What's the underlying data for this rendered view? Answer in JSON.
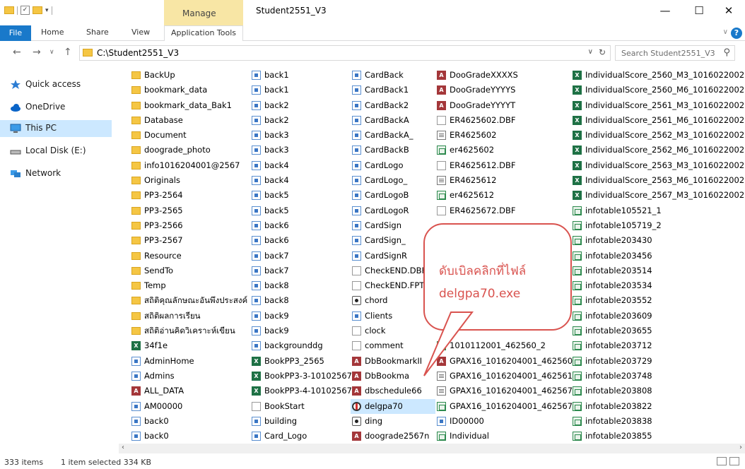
{
  "window": {
    "title": "Student2551_V3",
    "manage_label": "Manage",
    "minimize": "—",
    "maximize": "☐",
    "close": "✕"
  },
  "ribbon": {
    "tabs": [
      "File",
      "Home",
      "Share",
      "View",
      "Application Tools"
    ],
    "help": "?"
  },
  "address": {
    "path": "C:\\Student2551_V3",
    "search_placeholder": "Search Student2551_V3"
  },
  "nav": [
    {
      "label": "Quick access",
      "icon": "star-icon"
    },
    {
      "label": "OneDrive",
      "icon": "cloud-icon"
    },
    {
      "label": "This PC",
      "icon": "computer-icon",
      "selected": true
    },
    {
      "label": "Local Disk (E:)",
      "icon": "drive-icon"
    },
    {
      "label": "Network",
      "icon": "network-icon"
    }
  ],
  "columns": [
    {
      "items": [
        {
          "name": "BackUp",
          "type": "folder"
        },
        {
          "name": "bookmark_data",
          "type": "folder"
        },
        {
          "name": "bookmark_data_Bak1",
          "type": "folder"
        },
        {
          "name": "Database",
          "type": "folder"
        },
        {
          "name": "Document",
          "type": "folder"
        },
        {
          "name": "doograde_photo",
          "type": "folder"
        },
        {
          "name": "info1016204001@2567",
          "type": "folder"
        },
        {
          "name": "Originals",
          "type": "folder"
        },
        {
          "name": "PP3-2564",
          "type": "folder"
        },
        {
          "name": "PP3-2565",
          "type": "folder"
        },
        {
          "name": "PP3-2566",
          "type": "folder"
        },
        {
          "name": "PP3-2567",
          "type": "folder"
        },
        {
          "name": "Resource",
          "type": "folder"
        },
        {
          "name": "SendTo",
          "type": "folder"
        },
        {
          "name": "Temp",
          "type": "folder"
        },
        {
          "name": "สถิติคุณลักษณะอันพึงประสงค์",
          "type": "folder"
        },
        {
          "name": "สถิติผลการเรียน",
          "type": "folder"
        },
        {
          "name": "สถิติอ่านคิดวิเคราะห์เขียน",
          "type": "folder"
        },
        {
          "name": "34f1e",
          "type": "excel"
        },
        {
          "name": "AdminHome",
          "type": "form"
        },
        {
          "name": "Admins",
          "type": "form"
        },
        {
          "name": "ALL_DATA",
          "type": "access"
        },
        {
          "name": "AM00000",
          "type": "form"
        },
        {
          "name": "back0",
          "type": "form"
        },
        {
          "name": "back0",
          "type": "form"
        }
      ]
    },
    {
      "items": [
        {
          "name": "back1",
          "type": "form"
        },
        {
          "name": "back1",
          "type": "form"
        },
        {
          "name": "back2",
          "type": "form"
        },
        {
          "name": "back2",
          "type": "form"
        },
        {
          "name": "back3",
          "type": "form"
        },
        {
          "name": "back3",
          "type": "form"
        },
        {
          "name": "back4",
          "type": "form"
        },
        {
          "name": "back4",
          "type": "form"
        },
        {
          "name": "back5",
          "type": "form"
        },
        {
          "name": "back5",
          "type": "form"
        },
        {
          "name": "back6",
          "type": "form"
        },
        {
          "name": "back6",
          "type": "form"
        },
        {
          "name": "back7",
          "type": "form"
        },
        {
          "name": "back7",
          "type": "form"
        },
        {
          "name": "back8",
          "type": "form"
        },
        {
          "name": "back8",
          "type": "form"
        },
        {
          "name": "back9",
          "type": "form"
        },
        {
          "name": "back9",
          "type": "form"
        },
        {
          "name": "backgrounddg",
          "type": "form"
        },
        {
          "name": "BookPP3_2565",
          "type": "excel"
        },
        {
          "name": "BookPP3-3-10102567",
          "type": "excel"
        },
        {
          "name": "BookPP3-4-10102567",
          "type": "excel"
        },
        {
          "name": "BookStart",
          "type": "doc"
        },
        {
          "name": "building",
          "type": "form"
        },
        {
          "name": "Card_Logo",
          "type": "form"
        }
      ]
    },
    {
      "items": [
        {
          "name": "CardBack",
          "type": "form"
        },
        {
          "name": "CardBack1",
          "type": "form"
        },
        {
          "name": "CardBack2",
          "type": "form"
        },
        {
          "name": "CardBackA",
          "type": "form"
        },
        {
          "name": "CardBackA_",
          "type": "form"
        },
        {
          "name": "CardBackB",
          "type": "form"
        },
        {
          "name": "CardLogo",
          "type": "form"
        },
        {
          "name": "CardLogo_",
          "type": "form"
        },
        {
          "name": "CardLogoB",
          "type": "form"
        },
        {
          "name": "CardLogoR",
          "type": "form"
        },
        {
          "name": "CardSign",
          "type": "form"
        },
        {
          "name": "CardSign_",
          "type": "form"
        },
        {
          "name": "CardSignR",
          "type": "form"
        },
        {
          "name": "CheckEND.DBF",
          "type": "doc"
        },
        {
          "name": "CheckEND.FPT",
          "type": "doc"
        },
        {
          "name": "chord",
          "type": "chord"
        },
        {
          "name": "Clients",
          "type": "form"
        },
        {
          "name": "clock",
          "type": "doc"
        },
        {
          "name": "comment",
          "type": "doc"
        },
        {
          "name": "DbBookmarkII",
          "type": "access"
        },
        {
          "name": "DbBookma",
          "type": "access"
        },
        {
          "name": "dbschedule66",
          "type": "access"
        },
        {
          "name": "delgpa70",
          "type": "exe",
          "selected": true
        },
        {
          "name": "ding",
          "type": "chord"
        },
        {
          "name": "doograde2567n",
          "type": "access"
        }
      ]
    },
    {
      "items": [
        {
          "name": "DooGradeXXXXS",
          "type": "access"
        },
        {
          "name": "DooGradeYYYYS",
          "type": "access"
        },
        {
          "name": "DooGradeYYYYT",
          "type": "access"
        },
        {
          "name": "ER4625602.DBF",
          "type": "doc"
        },
        {
          "name": "ER4625602",
          "type": "dbf"
        },
        {
          "name": "er4625602",
          "type": "table"
        },
        {
          "name": "ER4625612.DBF",
          "type": "doc"
        },
        {
          "name": "ER4625612",
          "type": "dbf"
        },
        {
          "name": "er4625612",
          "type": "table"
        },
        {
          "name": "ER4625672.DBF",
          "type": "doc"
        },
        {
          "name": "",
          "type": "none"
        },
        {
          "name": "",
          "type": "none"
        },
        {
          "name": "",
          "type": "none"
        },
        {
          "name": "",
          "type": "none"
        },
        {
          "name": "",
          "type": "none"
        },
        {
          "name": "",
          "type": "none"
        },
        {
          "name": "",
          "type": "none"
        },
        {
          "name": "",
          "type": "none"
        },
        {
          "name": "1010112001_462560_2",
          "type": "table"
        },
        {
          "name": "GPAX16_1016204001_462560_2",
          "type": "access"
        },
        {
          "name": "GPAX16_1016204001_462561_2",
          "type": "dbf"
        },
        {
          "name": "GPAX16_1016204001_462567_2",
          "type": "dbf"
        },
        {
          "name": "GPAX16_1016204001_462567_2",
          "type": "table"
        },
        {
          "name": "ID00000",
          "type": "form"
        },
        {
          "name": "Individual",
          "type": "table"
        }
      ]
    },
    {
      "items": [
        {
          "name": "IndividualScore_2560_M3_1016022002",
          "type": "excel"
        },
        {
          "name": "IndividualScore_2560_M6_1016022002",
          "type": "excel"
        },
        {
          "name": "IndividualScore_2561_M3_1016022002",
          "type": "excel"
        },
        {
          "name": "IndividualScore_2561_M6_1016022002",
          "type": "excel"
        },
        {
          "name": "IndividualScore_2562_M3_1016022002",
          "type": "excel"
        },
        {
          "name": "IndividualScore_2562_M6_1016022002",
          "type": "excel"
        },
        {
          "name": "IndividualScore_2563_M3_1016022002",
          "type": "excel"
        },
        {
          "name": "IndividualScore_2563_M6_1016022002",
          "type": "excel"
        },
        {
          "name": "IndividualScore_2567_M3_1016022002",
          "type": "excel"
        },
        {
          "name": "infotable105521_1",
          "type": "table"
        },
        {
          "name": "infotable105719_2",
          "type": "table"
        },
        {
          "name": "infotable203430",
          "type": "table"
        },
        {
          "name": "infotable203456",
          "type": "table"
        },
        {
          "name": "infotable203514",
          "type": "table"
        },
        {
          "name": "infotable203534",
          "type": "table"
        },
        {
          "name": "infotable203552",
          "type": "table"
        },
        {
          "name": "infotable203609",
          "type": "table"
        },
        {
          "name": "infotable203655",
          "type": "table"
        },
        {
          "name": "infotable203712",
          "type": "table"
        },
        {
          "name": "infotable203729",
          "type": "table"
        },
        {
          "name": "infotable203748",
          "type": "table"
        },
        {
          "name": "infotable203808",
          "type": "table"
        },
        {
          "name": "infotable203822",
          "type": "table"
        },
        {
          "name": "infotable203838",
          "type": "table"
        },
        {
          "name": "infotable203855",
          "type": "table"
        }
      ]
    }
  ],
  "callout": {
    "line1": "ดับเบิลคลิกที่ไฟล์",
    "line2": "delgpa70.exe"
  },
  "status": {
    "count": "333 items",
    "selection": "1 item selected  334 KB"
  }
}
